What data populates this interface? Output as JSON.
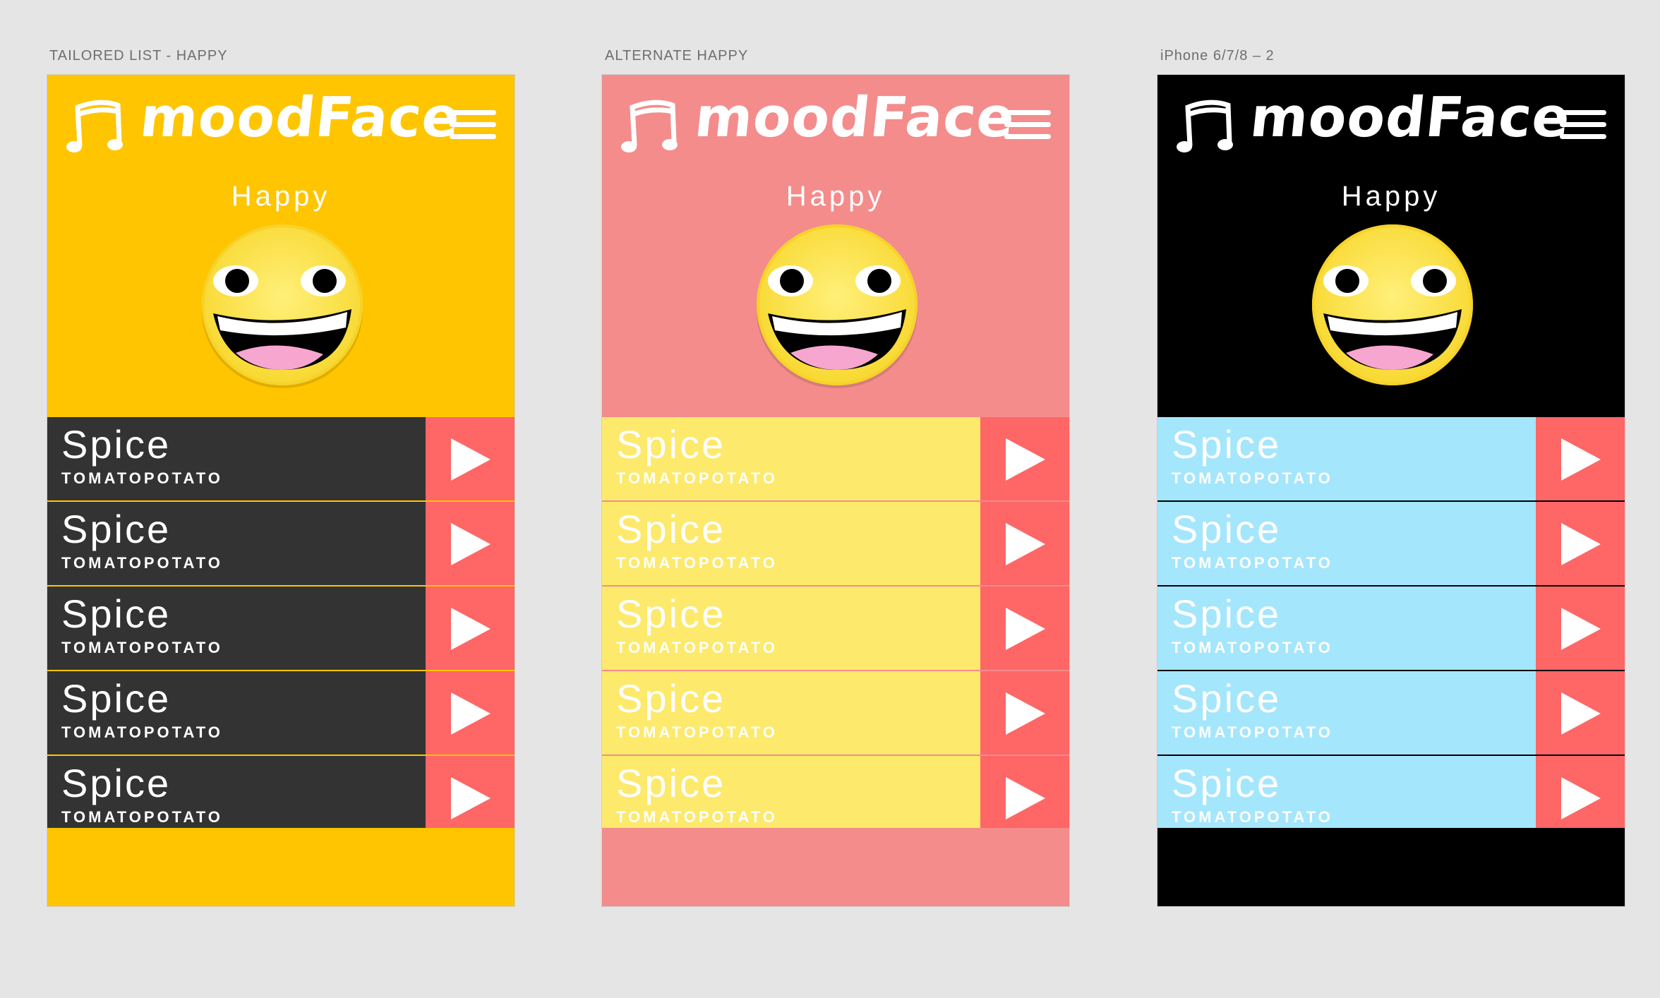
{
  "artboards": [
    {
      "label": "TAILORED LIST - HAPPY",
      "app_name": "moodFace",
      "mood": "Happy",
      "colors": {
        "background": "#ffc500",
        "row": "#333333",
        "divider": "#ffc500",
        "title": "#ffffff",
        "artist": "#ffffff",
        "play": "#ff6666"
      },
      "songs": [
        {
          "title": "Spice",
          "artist": "TOMATOPOTATO"
        },
        {
          "title": "Spice",
          "artist": "TOMATOPOTATO"
        },
        {
          "title": "Spice",
          "artist": "TOMATOPOTATO"
        },
        {
          "title": "Spice",
          "artist": "TOMATOPOTATO"
        },
        {
          "title": "Spice",
          "artist": "TOMATOPOTATO"
        }
      ]
    },
    {
      "label": "ALTERNATE HAPPY",
      "app_name": "moodFace",
      "mood": "Happy",
      "colors": {
        "background": "#f48c8c",
        "row": "#fde96b",
        "divider": "#f48c8c",
        "title": "#ffffff",
        "artist": "#ffffff",
        "play": "#ff6666"
      },
      "songs": [
        {
          "title": "Spice",
          "artist": "TOMATOPOTATO"
        },
        {
          "title": "Spice",
          "artist": "TOMATOPOTATO"
        },
        {
          "title": "Spice",
          "artist": "TOMATOPOTATO"
        },
        {
          "title": "Spice",
          "artist": "TOMATOPOTATO"
        },
        {
          "title": "Spice",
          "artist": "TOMATOPOTATO"
        }
      ]
    },
    {
      "label": "iPhone 6/7/8 – 2",
      "app_name": "moodFace",
      "mood": "Happy",
      "colors": {
        "background": "#000000",
        "row": "#a4e6fc",
        "divider": "#000000",
        "title": "#ffffff",
        "artist": "#ffffff",
        "play": "#ff6666"
      },
      "songs": [
        {
          "title": "Spice",
          "artist": "TOMATOPOTATO"
        },
        {
          "title": "Spice",
          "artist": "TOMATOPOTATO"
        },
        {
          "title": "Spice",
          "artist": "TOMATOPOTATO"
        },
        {
          "title": "Spice",
          "artist": "TOMATOPOTATO"
        },
        {
          "title": "Spice",
          "artist": "TOMATOPOTATO"
        }
      ]
    }
  ],
  "icons": {
    "logo": "music-note-icon",
    "menu": "hamburger-menu-icon",
    "mood": "happy-face-icon",
    "play": "play-icon"
  }
}
